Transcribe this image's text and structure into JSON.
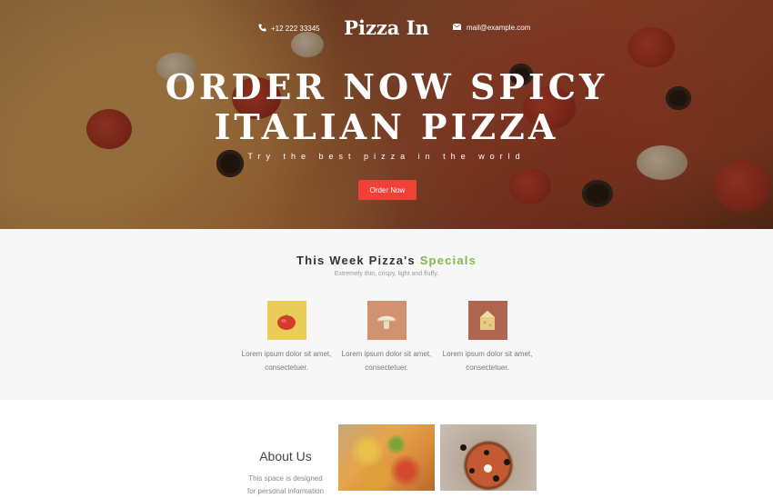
{
  "header": {
    "phone": "+12 222 33345",
    "logo": "Pizza In",
    "email": "mail@example.com"
  },
  "hero": {
    "headline_line1": "ORDER NOW SPICY",
    "headline_line2": "ITALIAN PIZZA",
    "tagline": "Try the best pizza in the world",
    "button_label": "Order Now"
  },
  "specials": {
    "title_prefix": "This Week Pizza's",
    "title_highlight": "Specials",
    "subtitle": "Extremely thin, crispy, light and fluffy.",
    "items": [
      {
        "icon": "tomato-icon",
        "text_line1": "Lorem ipsum dolor sit amet,",
        "text_line2": "consectetuer."
      },
      {
        "icon": "mushroom-icon",
        "text_line1": "Lorem ipsum dolor sit amet,",
        "text_line2": "consectetuer."
      },
      {
        "icon": "cheese-icon",
        "text_line1": "Lorem ipsum dolor sit amet,",
        "text_line2": "consectetuer."
      }
    ]
  },
  "about": {
    "title": "About Us",
    "text_line1": "This space is designed",
    "text_line2": "for personal information"
  },
  "colors": {
    "accent_red": "#ef4137",
    "accent_green": "#84b84c",
    "specials_bg": "#f7f7f7"
  }
}
